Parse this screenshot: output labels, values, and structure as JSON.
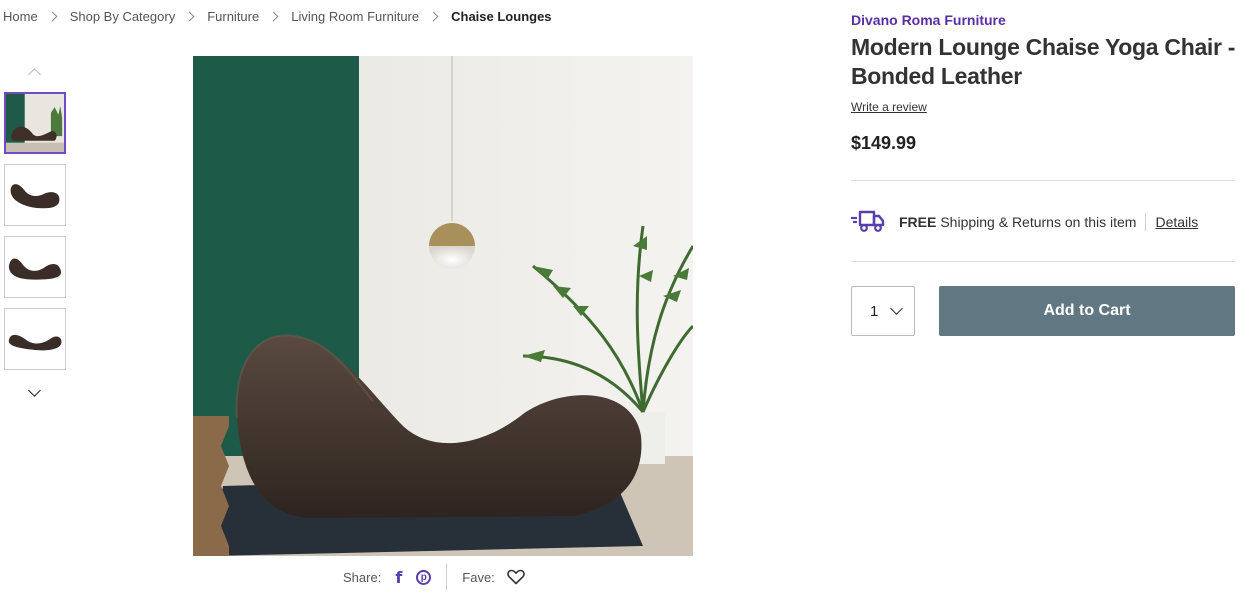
{
  "breadcrumb": {
    "items": [
      "Home",
      "Shop By Category",
      "Furniture",
      "Living Room Furniture"
    ],
    "current": "Chaise Lounges"
  },
  "product": {
    "brand": "Divano Roma Furniture",
    "title": "Modern Lounge Chaise Yoga Chair - Bonded Leather",
    "review_link": "Write a review",
    "price": "$149.99"
  },
  "shipping": {
    "free_label": "FREE",
    "text": "Shipping & Returns on this item",
    "details_link": "Details",
    "icon": "truck-icon"
  },
  "purchase": {
    "quantity": "1",
    "add_to_cart": "Add to Cart"
  },
  "share": {
    "share_label": "Share:",
    "fave_label": "Fave:",
    "facebook_glyph": "f",
    "pinterest_glyph": "p"
  },
  "colors": {
    "brand": "#5a2ea6",
    "accent": "#5b3dab",
    "cart_button": "#617883"
  }
}
